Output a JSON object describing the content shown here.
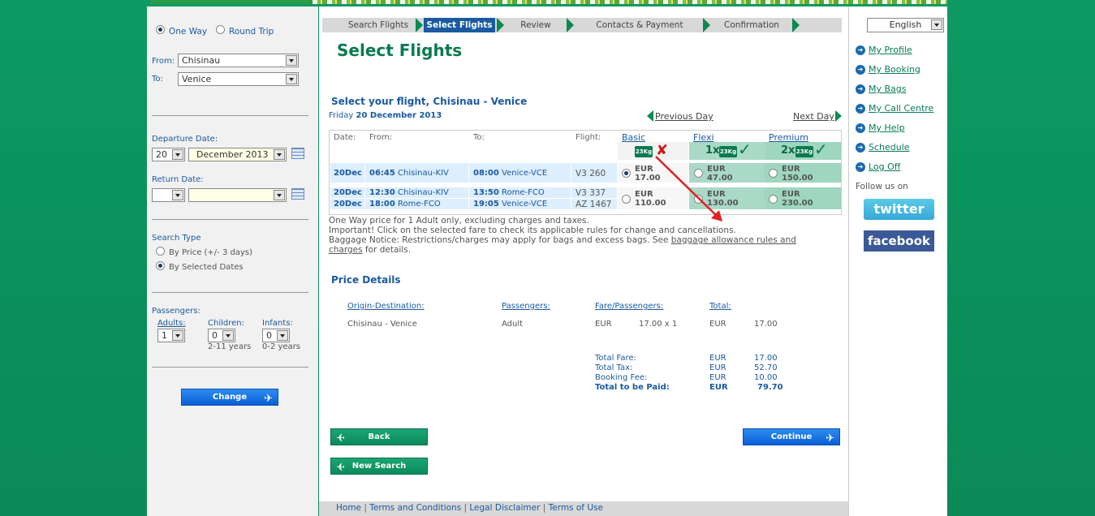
{
  "trip": {
    "one_way": "One Way",
    "round_trip": "Round Trip"
  },
  "search": {
    "from_label": "From:",
    "from_value": "Chisinau",
    "to_label": "To:",
    "to_value": "Venice",
    "departure_label": "Departure Date:",
    "dep_day": "20",
    "dep_month": "December 2013",
    "return_label": "Return Date:",
    "search_type_label": "Search Type",
    "by_price": "By Price (+/- 3 days)",
    "by_dates": "By Selected Dates",
    "passengers_label": "Passengers:",
    "adults_label": "Adults:",
    "adults_value": "1",
    "children_label": "Children:",
    "children_value": "0",
    "children_age": "2-11 years",
    "infants_label": "Infants:",
    "infants_value": "0",
    "infants_age": "0-2 years",
    "change_button": "Change"
  },
  "steps": [
    "Search Flights",
    "Select Flights",
    "Review",
    "Contacts & Payment",
    "Confirmation"
  ],
  "page_title": "Select Flights",
  "flight_heading": "Select your flight, Chisinau - Venice",
  "date_prefix": "Friday",
  "date_value": "20 December 2013",
  "prev_day": "Previous Day",
  "next_day": "Next Day",
  "table": {
    "headers": {
      "date": "Date:",
      "from": "From:",
      "to": "To:",
      "flight": "Flight:",
      "basic": "Basic",
      "flexi": "Flexi",
      "premium": "Premium"
    },
    "bag_kg": "23Kg",
    "flexi_mult": "1x",
    "premium_mult": "2x",
    "rows": [
      {
        "date": "20Dec",
        "dep_time": "06:45",
        "dep": "Chisinau-KIV",
        "arr_time": "08:00",
        "arr": "Venice-VCE",
        "flight": "V3 260",
        "basic_cur": "EUR",
        "basic": "17.00",
        "flexi_cur": "EUR",
        "flexi": "47.00",
        "premium_cur": "EUR",
        "premium": "150.00"
      },
      {
        "date": "20Dec",
        "dep_time": "12:30",
        "dep": "Chisinau-KIV",
        "arr_time": "13:50",
        "arr": "Rome-FCO",
        "flight": "V3 337",
        "basic_cur": "EUR",
        "basic": "110.00",
        "flexi_cur": "EUR",
        "flexi": "130.00",
        "premium_cur": "EUR",
        "premium": "230.00"
      },
      {
        "date": "20Dec",
        "dep_time": "18:00",
        "dep": "Rome-FCO",
        "arr_time": "19:05",
        "arr": "Venice-VCE",
        "flight": "AZ 1467"
      }
    ]
  },
  "notes": {
    "line1": "One Way price for 1 Adult only, excluding charges and taxes.",
    "line2": "Important! Click on the selected fare to check its applicable rules for change and cancellations.",
    "line3_pre": "Baggage Notice: Restrictions/charges may apply for bags and excess bags. See ",
    "line3_link_a": "baggage allowance rules and",
    "line3_link_b": "charges",
    "line3_post": " for details."
  },
  "price": {
    "heading": "Price Details",
    "col_od": "Origin-Destination:",
    "col_pax": "Passengers:",
    "col_fare": "Fare/Passengers:",
    "col_total": "Total:",
    "od": "Chisinau - Venice",
    "pax": "Adult",
    "fare_cur": "EUR",
    "fare": "17.00 x 1",
    "total_cur": "EUR",
    "total": "17.00",
    "summary": [
      {
        "label": "Total Fare:",
        "cur": "EUR",
        "value": "17.00"
      },
      {
        "label": "Total Tax:",
        "cur": "EUR",
        "value": "52.70"
      },
      {
        "label": "Booking Fee:",
        "cur": "EUR",
        "value": "10.00"
      },
      {
        "label": "Total to be Paid:",
        "cur": "EUR",
        "value": "79.70"
      }
    ]
  },
  "buttons": {
    "back": "Back",
    "continue": "Continue",
    "new_search": "New Search"
  },
  "language": "English",
  "right_nav": [
    "My Profile",
    "My Booking",
    "My Bags",
    "My Call Centre",
    "My Help",
    "Schedule",
    "Log Off"
  ],
  "follow": "Follow us on",
  "social": {
    "twitter": "twitter",
    "facebook": "facebook"
  },
  "footer": [
    "Home",
    "Terms and Conditions",
    "Legal Disclaimer",
    "Terms of Use"
  ],
  "colors": {
    "brand_green": "#0a8a5a",
    "link_blue": "#1a5aa0",
    "accent_red": "#e02020"
  }
}
